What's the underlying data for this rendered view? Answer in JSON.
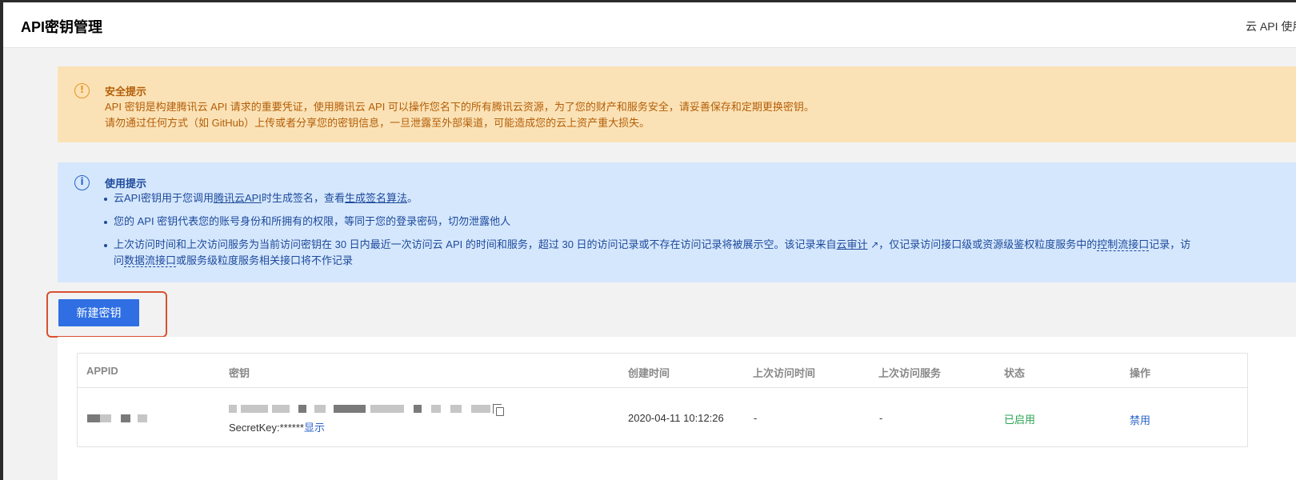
{
  "header": {
    "title": "API密钥管理",
    "right_link": "云 API 使用"
  },
  "warning": {
    "title": "安全提示",
    "line1": "API 密钥是构建腾讯云 API 请求的重要凭证，使用腾讯云 API 可以操作您名下的所有腾讯云资源，为了您的财产和服务安全，请妥善保存和定期更换密钥。",
    "line2": "请勿通过任何方式（如 GitHub）上传或者分享您的密钥信息，一旦泄露至外部渠道，可能造成您的云上资产重大损失。",
    "icon": "exclamation-circle-icon",
    "color": "#e69421"
  },
  "usage": {
    "title": "使用提示",
    "icon": "info-circle-icon",
    "item1_prefix": "云API密钥用于您调用",
    "item1_link1": "腾讯云API",
    "item1_middle": "时生成签名，查看",
    "item1_link2": "生成签名算法",
    "item1_suffix": "。",
    "item2": "您的 API 密钥代表您的账号身份和所拥有的权限，等同于您的登录密码，切勿泄露他人",
    "item3_prefix": "上次访问时间和上次访问服务为当前访问密钥在 30 日内最近一次访问云 API 的时间和服务，超过 30 日的访问记录或不存在访问记录将被展示空。该记录来自",
    "item3_link1": "云审计",
    "item3_middle": "，仅记录访问接口级或资源级鉴权粒度服务中的",
    "item3_link2": "控制流接口",
    "item3_middle2": "记录，访",
    "item3_line2_prefix": "问",
    "item3_link3": "数据流接口",
    "item3_suffix": "或服务级粒度服务相关接口将不作记录"
  },
  "actions": {
    "create_label": "新建密钥",
    "button_color": "#2f6fe3",
    "highlight_color": "#d9502f"
  },
  "table": {
    "columns": [
      "APPID",
      "密钥",
      "创建时间",
      "上次访问时间",
      "上次访问服务",
      "状态",
      "操作"
    ],
    "rows": [
      {
        "secret_key_label": "SecretKey:******",
        "show_label": "显示",
        "created": "2020-04-11 10:12:26",
        "last_access_time": "-",
        "last_access_service": "-",
        "status": "已启用",
        "status_color": "#29a352",
        "action": "禁用"
      }
    ]
  }
}
